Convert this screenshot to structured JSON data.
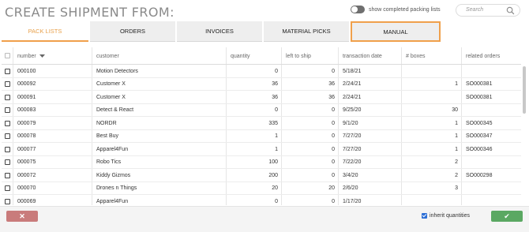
{
  "title": "CREATE SHIPMENT FROM:",
  "toggle": {
    "label": "show completed packing lists"
  },
  "search": {
    "placeholder": "Search"
  },
  "tabs": [
    {
      "label": "PACK LISTS"
    },
    {
      "label": "ORDERS"
    },
    {
      "label": "INVOICES"
    },
    {
      "label": "MATERIAL PICKS"
    },
    {
      "label": "MANUAL"
    }
  ],
  "columns": [
    "number",
    "customer",
    "quantity",
    "left to ship",
    "transaction date",
    "# boxes",
    "related orders"
  ],
  "rows": [
    {
      "number": "000100",
      "customer": "Motion Detectors",
      "quantity": "0",
      "left": "0",
      "date": "5/18/21",
      "boxes": "",
      "orders": ""
    },
    {
      "number": "000092",
      "customer": "Customer X",
      "quantity": "36",
      "left": "36",
      "date": "2/24/21",
      "boxes": "1",
      "orders": "SO000381"
    },
    {
      "number": "000091",
      "customer": "Customer X",
      "quantity": "36",
      "left": "36",
      "date": "2/24/21",
      "boxes": "",
      "orders": "SO000381"
    },
    {
      "number": "000083",
      "customer": "Detect & React",
      "quantity": "0",
      "left": "0",
      "date": "9/25/20",
      "boxes": "30",
      "orders": ""
    },
    {
      "number": "000079",
      "customer": "NORDR",
      "quantity": "335",
      "left": "0",
      "date": "9/1/20",
      "boxes": "1",
      "orders": "SO000345"
    },
    {
      "number": "000078",
      "customer": "Best Buy",
      "quantity": "1",
      "left": "0",
      "date": "7/27/20",
      "boxes": "1",
      "orders": "SO000347"
    },
    {
      "number": "000077",
      "customer": "Apparel4Fun",
      "quantity": "1",
      "left": "0",
      "date": "7/27/20",
      "boxes": "1",
      "orders": "SO000346"
    },
    {
      "number": "000075",
      "customer": "Robo Tics",
      "quantity": "100",
      "left": "0",
      "date": "7/22/20",
      "boxes": "2",
      "orders": ""
    },
    {
      "number": "000072",
      "customer": "Kiddy Gizmos",
      "quantity": "200",
      "left": "0",
      "date": "3/4/20",
      "boxes": "2",
      "orders": "SO000298"
    },
    {
      "number": "000070",
      "customer": "Drones n Things",
      "quantity": "20",
      "left": "20",
      "date": "2/6/20",
      "boxes": "3",
      "orders": ""
    },
    {
      "number": "000069",
      "customer": "Apparel4Fun",
      "quantity": "0",
      "left": "0",
      "date": "1/17/20",
      "boxes": "",
      "orders": ""
    }
  ],
  "footer": {
    "cancel_icon": "close-icon",
    "confirm_icon": "check-icon",
    "inherit_label": "inherit quantities",
    "cancel_glyph": "✕",
    "confirm_glyph": "✔"
  }
}
